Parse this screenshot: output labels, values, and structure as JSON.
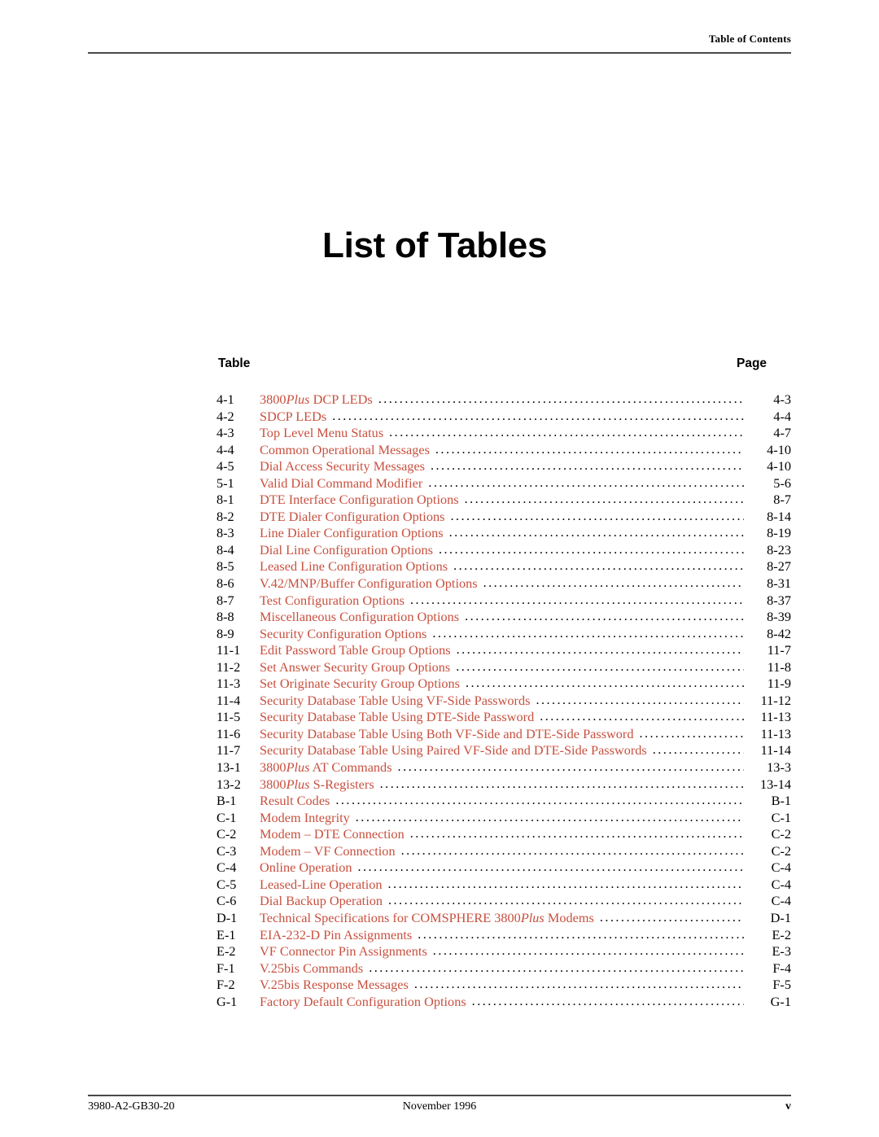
{
  "header": {
    "running_head": "Table of Contents"
  },
  "title": "List of Tables",
  "columns": {
    "table_label": "Table",
    "page_label": "Page"
  },
  "colors": {
    "entry_red": "#c8503f",
    "text_black": "#000000",
    "rule_gray": "#4a4a4a"
  },
  "entries": [
    {
      "num": "4-1",
      "title_pre": "3800",
      "title_italic": "Plus",
      "title_post": " DCP LEDs",
      "page": "4-3"
    },
    {
      "num": "4-2",
      "title_pre": "SDCP LEDs",
      "title_italic": "",
      "title_post": "",
      "page": "4-4"
    },
    {
      "num": "4-3",
      "title_pre": "Top Level Menu Status",
      "title_italic": "",
      "title_post": "",
      "page": "4-7"
    },
    {
      "num": "4-4",
      "title_pre": "Common Operational Messages",
      "title_italic": "",
      "title_post": "",
      "page": "4-10"
    },
    {
      "num": "4-5",
      "title_pre": "Dial Access Security Messages",
      "title_italic": "",
      "title_post": "",
      "page": "4-10"
    },
    {
      "num": "5-1",
      "title_pre": "Valid Dial Command Modifier",
      "title_italic": "",
      "title_post": "",
      "page": "5-6"
    },
    {
      "num": "8-1",
      "title_pre": "DTE Interface Configuration Options",
      "title_italic": "",
      "title_post": "",
      "page": "8-7"
    },
    {
      "num": "8-2",
      "title_pre": "DTE Dialer Configuration Options",
      "title_italic": "",
      "title_post": "",
      "page": "8-14"
    },
    {
      "num": "8-3",
      "title_pre": "Line Dialer Configuration Options",
      "title_italic": "",
      "title_post": "",
      "page": "8-19"
    },
    {
      "num": "8-4",
      "title_pre": "Dial Line Configuration Options",
      "title_italic": "",
      "title_post": "",
      "page": "8-23"
    },
    {
      "num": "8-5",
      "title_pre": "Leased Line Configuration Options",
      "title_italic": "",
      "title_post": "",
      "page": "8-27"
    },
    {
      "num": "8-6",
      "title_pre": "V.42/MNP/Buffer Configuration Options",
      "title_italic": "",
      "title_post": "",
      "page": "8-31"
    },
    {
      "num": "8-7",
      "title_pre": "Test Configuration Options",
      "title_italic": "",
      "title_post": "",
      "page": "8-37"
    },
    {
      "num": "8-8",
      "title_pre": "Miscellaneous Configuration Options",
      "title_italic": "",
      "title_post": "",
      "page": "8-39"
    },
    {
      "num": "8-9",
      "title_pre": "Security Configuration Options",
      "title_italic": "",
      "title_post": "",
      "page": "8-42"
    },
    {
      "num": "11-1",
      "title_pre": "Edit Password Table Group Options",
      "title_italic": "",
      "title_post": "",
      "page": "11-7"
    },
    {
      "num": "11-2",
      "title_pre": "Set Answer Security Group Options",
      "title_italic": "",
      "title_post": "",
      "page": "11-8"
    },
    {
      "num": "11-3",
      "title_pre": "Set Originate Security Group Options",
      "title_italic": "",
      "title_post": "",
      "page": "11-9"
    },
    {
      "num": "11-4",
      "title_pre": "Security Database Table Using VF-Side Passwords",
      "title_italic": "",
      "title_post": "",
      "page": "11-12"
    },
    {
      "num": "11-5",
      "title_pre": "Security Database Table Using DTE-Side Password",
      "title_italic": "",
      "title_post": "",
      "page": "11-13"
    },
    {
      "num": "11-6",
      "title_pre": "Security Database Table Using Both VF-Side and DTE-Side Password",
      "title_italic": "",
      "title_post": "",
      "page": "11-13"
    },
    {
      "num": "11-7",
      "title_pre": "Security Database Table Using Paired VF-Side and DTE-Side Passwords",
      "title_italic": "",
      "title_post": "",
      "page": "11-14"
    },
    {
      "num": "13-1",
      "title_pre": "3800",
      "title_italic": "Plus",
      "title_post": " AT Commands",
      "page": "13-3"
    },
    {
      "num": "13-2",
      "title_pre": "3800",
      "title_italic": "Plus",
      "title_post": " S-Registers",
      "page": "13-14"
    },
    {
      "num": "B-1",
      "title_pre": "Result Codes",
      "title_italic": "",
      "title_post": "",
      "page": "B-1"
    },
    {
      "num": "C-1",
      "title_pre": "Modem Integrity",
      "title_italic": "",
      "title_post": "",
      "page": "C-1"
    },
    {
      "num": "C-2",
      "title_pre": "Modem – DTE Connection",
      "title_italic": "",
      "title_post": "",
      "page": "C-2"
    },
    {
      "num": "C-3",
      "title_pre": "Modem – VF Connection",
      "title_italic": "",
      "title_post": "",
      "page": "C-2"
    },
    {
      "num": "C-4",
      "title_pre": "Online Operation",
      "title_italic": "",
      "title_post": "",
      "page": "C-4"
    },
    {
      "num": "C-5",
      "title_pre": "Leased-Line Operation",
      "title_italic": "",
      "title_post": "",
      "page": "C-4"
    },
    {
      "num": "C-6",
      "title_pre": "Dial Backup Operation",
      "title_italic": "",
      "title_post": "",
      "page": "C-4"
    },
    {
      "num": "D-1",
      "title_pre": "Technical Specifications for COMSPHERE 3800",
      "title_italic": "Plus",
      "title_post": " Modems",
      "page": "D-1"
    },
    {
      "num": "E-1",
      "title_pre": "EIA-232-D Pin Assignments",
      "title_italic": "",
      "title_post": "",
      "page": "E-2"
    },
    {
      "num": "E-2",
      "title_pre": "VF Connector Pin Assignments",
      "title_italic": "",
      "title_post": "",
      "page": "E-3"
    },
    {
      "num": "F-1",
      "title_pre": "V.25bis Commands",
      "title_italic": "",
      "title_post": "",
      "page": "F-4"
    },
    {
      "num": "F-2",
      "title_pre": "V.25bis Response Messages",
      "title_italic": "",
      "title_post": "",
      "page": "F-5"
    },
    {
      "num": "G-1",
      "title_pre": "Factory Default Configuration Options",
      "title_italic": "",
      "title_post": "",
      "page": "G-1"
    }
  ],
  "footer": {
    "doc_number": "3980-A2-GB30-20",
    "date": "November 1996",
    "page_number": "v"
  }
}
